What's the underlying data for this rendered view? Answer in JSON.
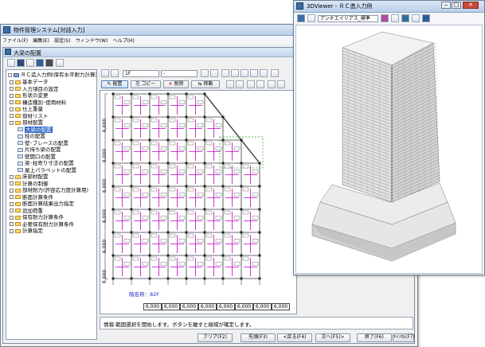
{
  "main_window": {
    "title": "物件管理システム[対話入力]",
    "menu": [
      "ファイル(F)",
      "編集(E)",
      "設定(S)",
      "ウィンドウ(W)",
      "ヘルプ(H)"
    ]
  },
  "sub_window": {
    "title": "大梁の配置",
    "tree_root": "ＲＣ造入力例(保有水平耐力計算)",
    "tree_items": [
      {
        "label": "基本データ",
        "level": 1
      },
      {
        "label": "入力項目の設定",
        "level": 1
      },
      {
        "label": "形状の変更",
        "level": 1
      },
      {
        "label": "構造種別･使用材料",
        "level": 1
      },
      {
        "label": "仕上重量",
        "level": 1
      },
      {
        "label": "部材リスト",
        "level": 1
      },
      {
        "label": "部材配置",
        "level": 1
      },
      {
        "label": "大梁の配置",
        "level": 2,
        "selected": true
      },
      {
        "label": "柱の配置",
        "level": 2
      },
      {
        "label": "壁･ブレースの配置",
        "level": 2
      },
      {
        "label": "片持ち梁の配置",
        "level": 2
      },
      {
        "label": "壁開口の配置",
        "level": 2
      },
      {
        "label": "梁･柱寄り寸法の配置",
        "level": 2
      },
      {
        "label": "屋上パラペットの配置",
        "level": 2
      },
      {
        "label": "床部材配置",
        "level": 1
      },
      {
        "label": "計算の制御",
        "level": 1
      },
      {
        "label": "部材耐力(許容応力度計算用)",
        "level": 1
      },
      {
        "label": "断面計算条件",
        "level": 1
      },
      {
        "label": "断面計算結果出力指定",
        "level": 1
      },
      {
        "label": "追加荷重",
        "level": 1
      },
      {
        "label": "保有耐力計算条件",
        "level": 1
      },
      {
        "label": "必要保有耐力計算条件",
        "level": 1
      },
      {
        "label": "計算指定",
        "level": 1
      }
    ],
    "floor_combo": "1F",
    "floor_combo2": "-",
    "action_buttons": {
      "place": "配置",
      "copy": "コピー",
      "delete": "削除",
      "move": "移動"
    },
    "floor_name_label": "階名称：82F",
    "dimension_labels": [
      "6,000",
      "6,000",
      "6,000",
      "6,000",
      "6,000",
      "6,000",
      "6,000",
      "6,000"
    ],
    "vertical_dims": [
      "6,000",
      "6,000",
      "6,000",
      "6,000",
      "6,000",
      "6,000"
    ],
    "status_text": "情報:範囲選択を開始します。ボタンを離すと線域が確定します。",
    "bottom_buttons": [
      "クリア(F2)",
      "先頭(F3)",
      "<戻る(F4)",
      "次へ(F5)>",
      "終了(F6)",
      "ｷｬﾝｾﾙ(F7)"
    ]
  },
  "viewer_window": {
    "title": "3DViewer - ＲＣ造入力例",
    "combo": "アンチエイリアス_標準"
  },
  "colors": {
    "beam": "#c000c0",
    "grid": "#3a3a3a",
    "selection": "#3169c6",
    "building_light": "#e2e2e2",
    "building_dark": "#8a8a8a",
    "green_dash": "#22aa22"
  }
}
